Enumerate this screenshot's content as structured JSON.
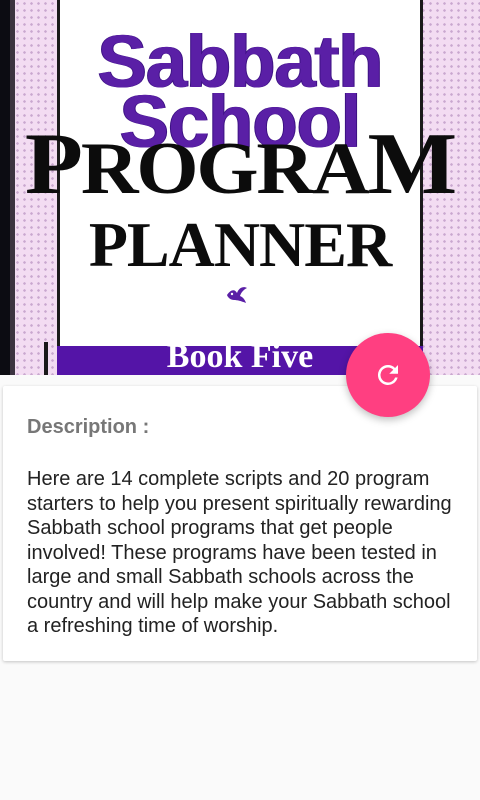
{
  "cover": {
    "line1": "Sabbath",
    "line2": "School",
    "line3_first": "P",
    "line3_rest": "ROGRA",
    "line3_last": "M",
    "line4": "PLANNER",
    "band_text": "Book Five",
    "logo_icon": "dove-logo-icon"
  },
  "description": {
    "label": "Description :",
    "body": "Here are 14 complete scripts and 20 program starters to help you present spiritually rewarding Sabbath school programs that get people involved! These programs have been tested in large and small Sabbath schools across the country and will help make your Sabbath school a refreshing time of worship."
  },
  "fab": {
    "icon": "refresh-icon",
    "color": "#ff3f81"
  },
  "colors": {
    "cover_purple": "#5a1fa6",
    "cover_band": "#5414a7",
    "cover_bg": "#f3dcf2",
    "label_gray": "#777777",
    "body_text": "#222222"
  }
}
